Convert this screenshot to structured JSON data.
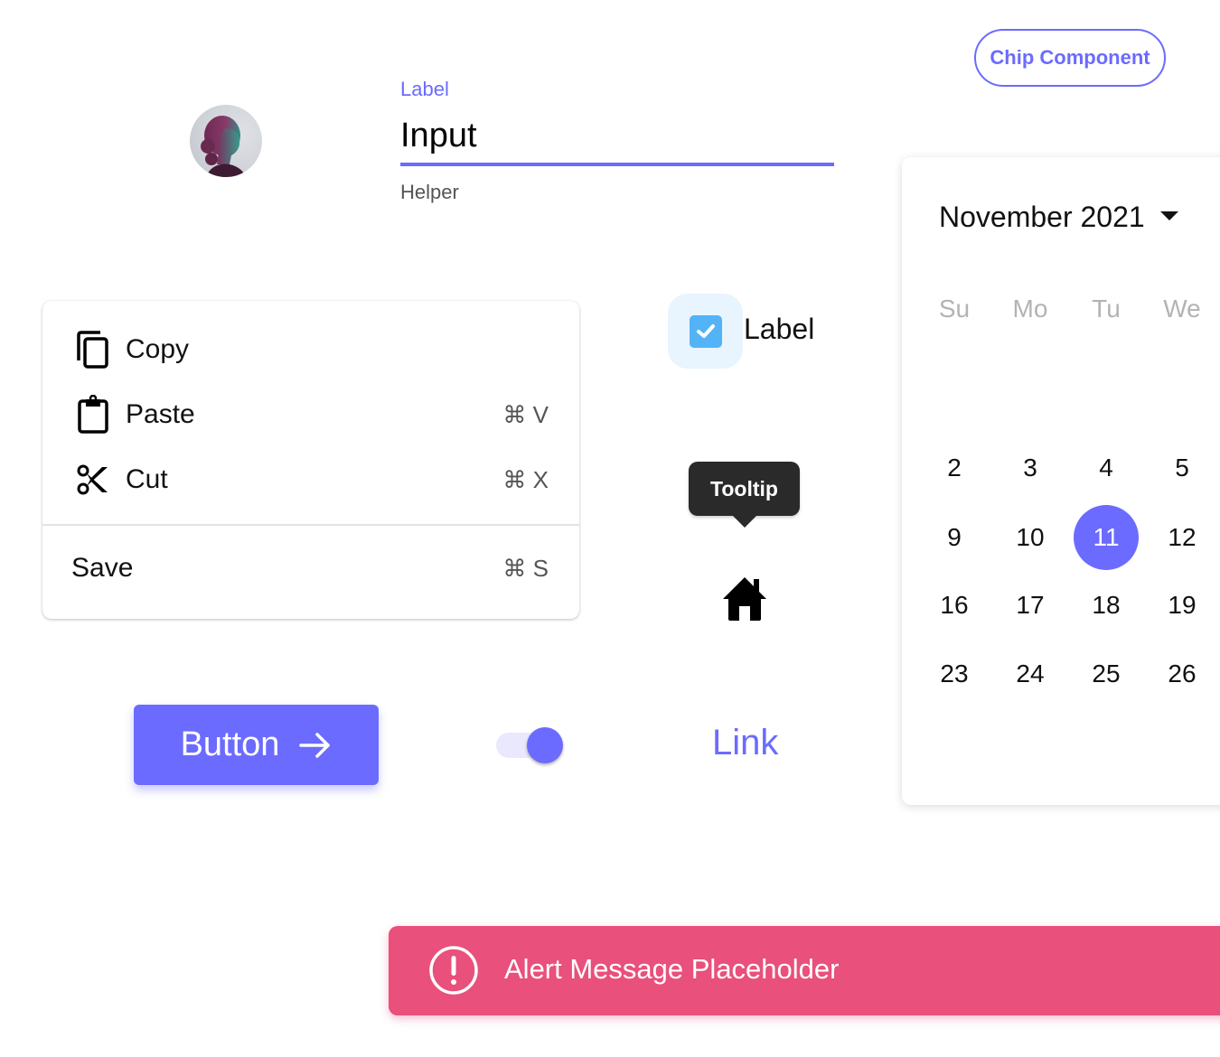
{
  "avatar": {
    "alt": "user-avatar"
  },
  "text_field": {
    "label": "Label",
    "value": "Input",
    "helper": "Helper"
  },
  "chip": {
    "label": "Chip Component"
  },
  "menu": {
    "items": [
      {
        "label": "Copy",
        "icon": "copy-icon",
        "shortcut": ""
      },
      {
        "label": "Paste",
        "icon": "paste-icon",
        "shortcut": "⌘ V"
      },
      {
        "label": "Cut",
        "icon": "cut-icon",
        "shortcut": "⌘ X"
      }
    ],
    "save": {
      "label": "Save",
      "shortcut": "⌘ S"
    }
  },
  "checkbox": {
    "label": "Label",
    "checked": true
  },
  "tooltip": {
    "text": "Tooltip",
    "anchor_icon": "home-icon"
  },
  "calendar": {
    "title": "November 2021",
    "weekdays": [
      "Su",
      "Mo",
      "Tu",
      "We"
    ],
    "weeks": [
      [
        "2",
        "3",
        "4",
        "5"
      ],
      [
        "9",
        "10",
        "11",
        "12"
      ],
      [
        "16",
        "17",
        "18",
        "19"
      ],
      [
        "23",
        "24",
        "25",
        "26"
      ]
    ],
    "selected_day": "11"
  },
  "button": {
    "label": "Button",
    "icon": "arrow-right-icon"
  },
  "toggle": {
    "on": true
  },
  "link": {
    "label": "Link"
  },
  "alert": {
    "message": "Alert Message Placeholder",
    "icon": "alert-circle-icon"
  },
  "colors": {
    "primary": "#6b6bff",
    "alert": "#e9507c",
    "checkbox": "#52b4f7",
    "tooltip_bg": "#2a2a2a"
  }
}
